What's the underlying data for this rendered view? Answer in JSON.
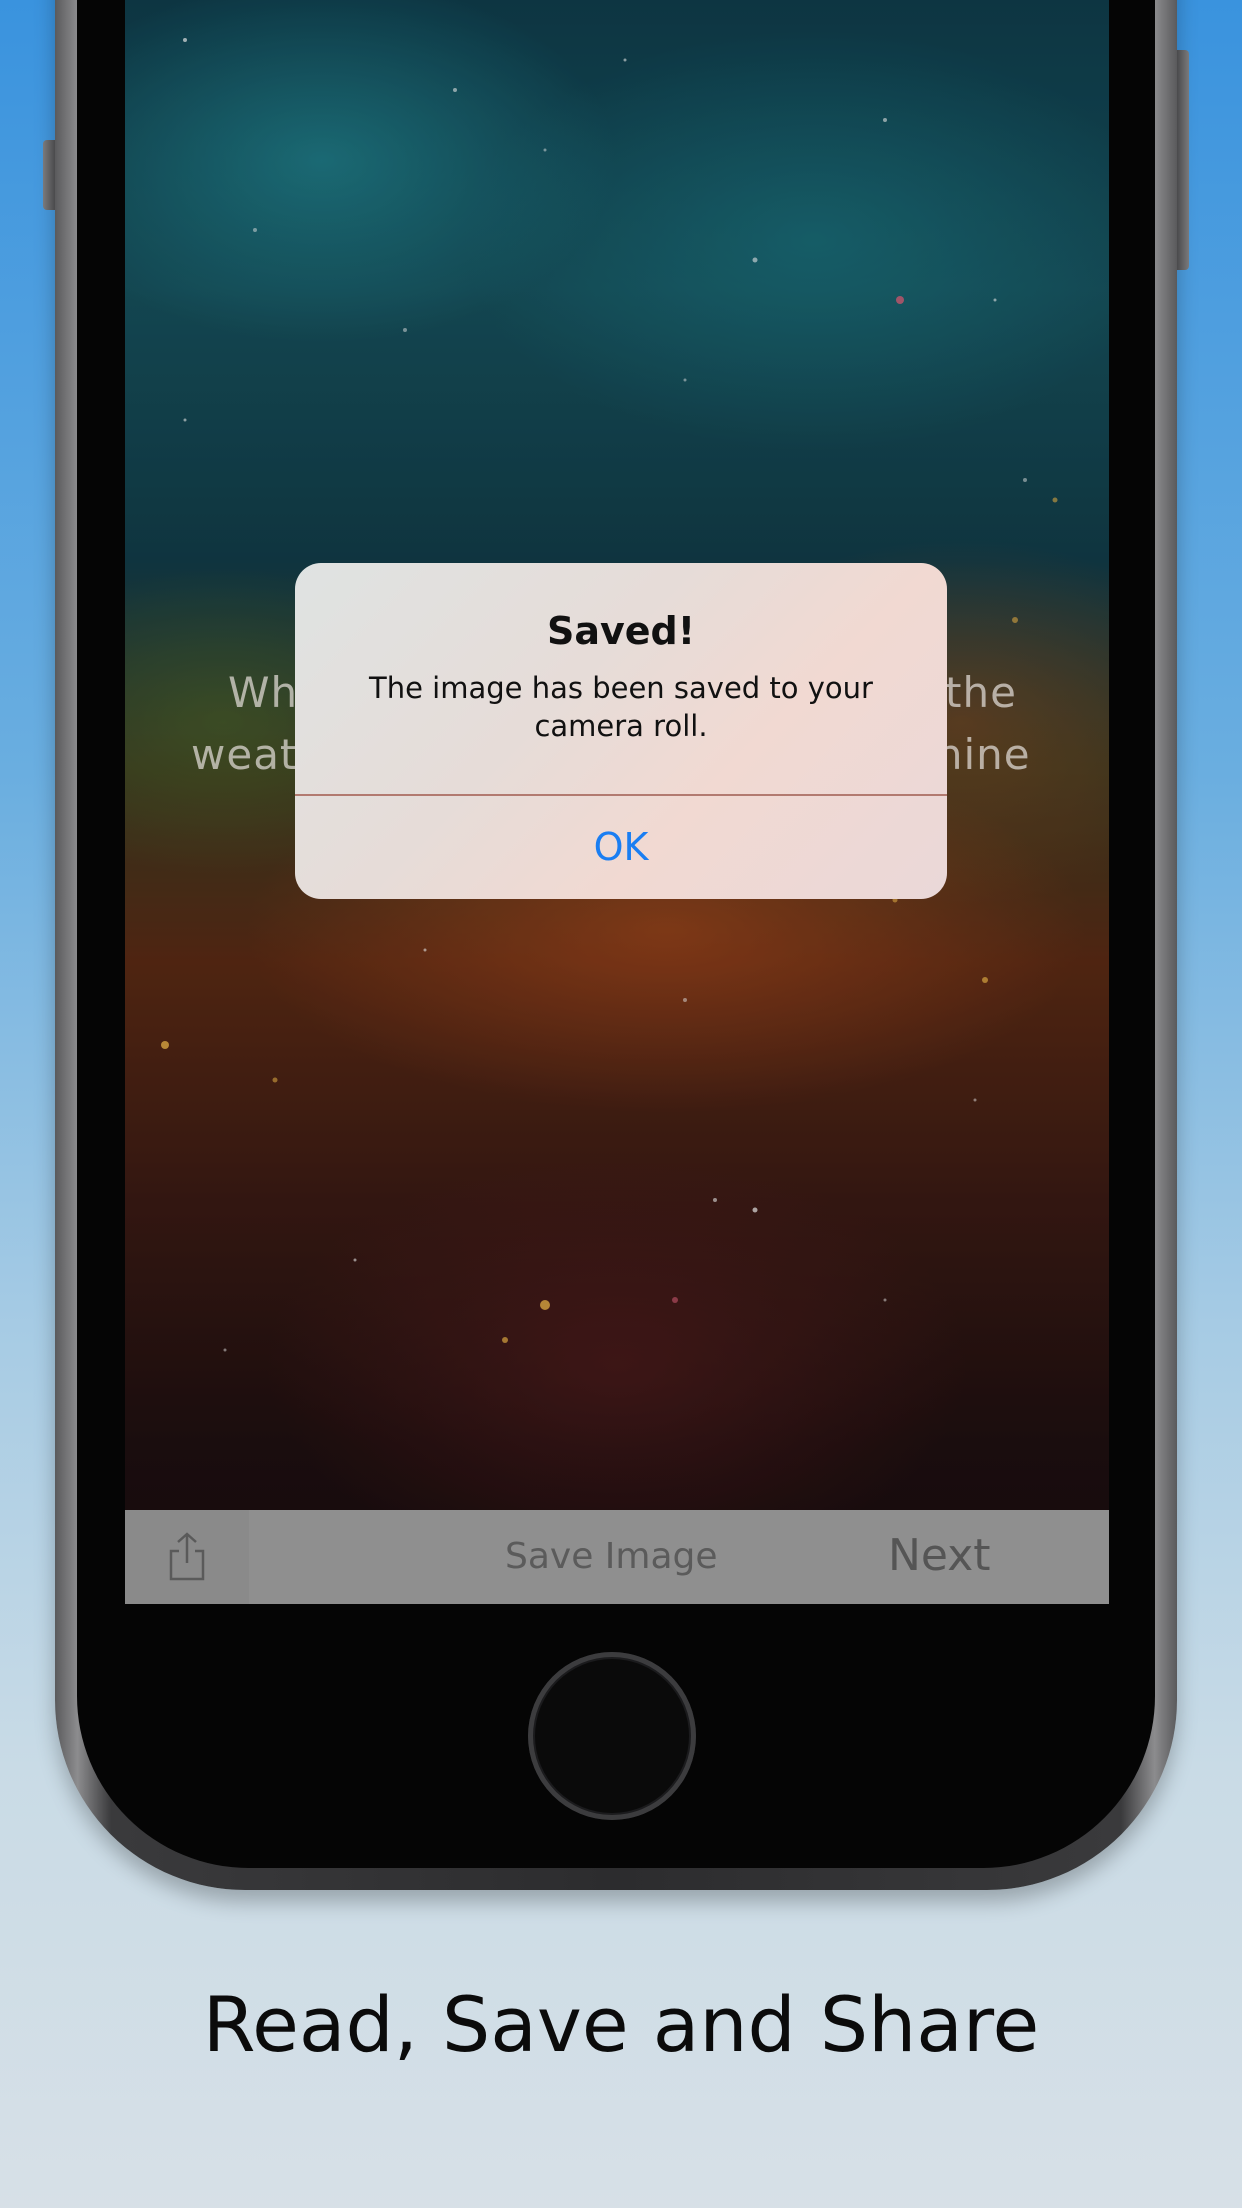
{
  "screen": {
    "quote": {
      "line1_left": "Wh",
      "line1_right": "the",
      "line2_left": "weat",
      "line2_right": "shine"
    }
  },
  "alert": {
    "title": "Saved!",
    "message": "The image has been saved to your camera roll.",
    "ok_label": "OK"
  },
  "toolbar": {
    "share_icon": "share-icon",
    "save_label": "Save Image",
    "next_label": "Next"
  },
  "caption": "Read, Save and Share",
  "colors": {
    "accent": "#1a7ef2",
    "toolbar": "#8f8f8f"
  }
}
